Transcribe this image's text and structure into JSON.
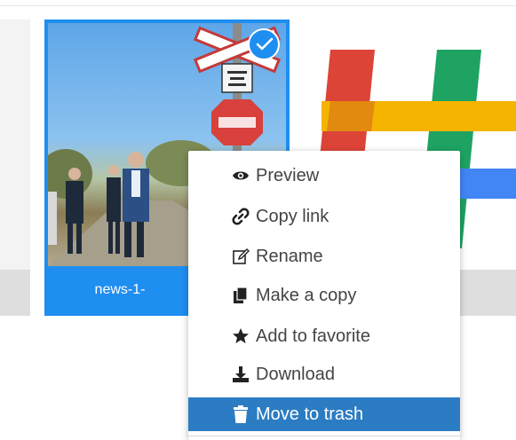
{
  "file_card": {
    "filename": "news-1-",
    "selected": true
  },
  "context_menu": {
    "items": [
      {
        "label": "Preview",
        "icon": "eye-icon"
      },
      {
        "label": "Copy link",
        "icon": "link-icon"
      },
      {
        "label": "Rename",
        "icon": "edit-icon"
      },
      {
        "label": "Make a copy",
        "icon": "copy-icon"
      },
      {
        "label": "Add to favorite",
        "icon": "star-icon"
      },
      {
        "label": "Download",
        "icon": "download-icon"
      },
      {
        "label": "Move to trash",
        "icon": "trash-icon"
      }
    ],
    "active_index": 6
  },
  "colors": {
    "selection_blue": "#1f8ef1",
    "menu_active": "#2b7cc2",
    "menu_text": "#444444"
  }
}
